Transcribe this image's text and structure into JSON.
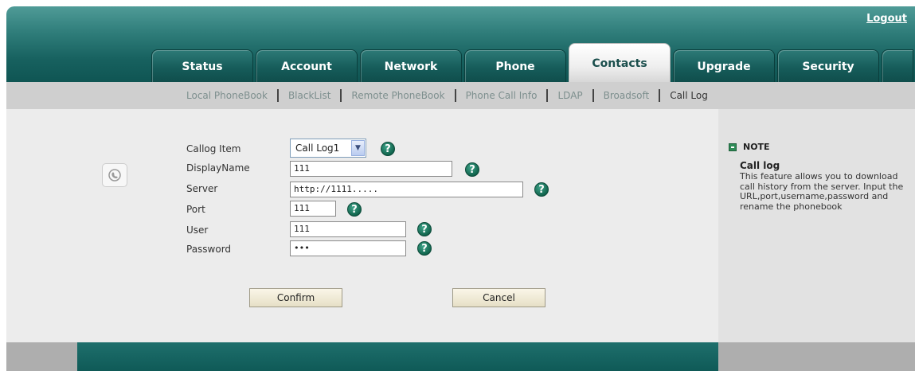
{
  "header": {
    "logout_label": "Logout"
  },
  "tabs": [
    {
      "label": "Status",
      "active": false
    },
    {
      "label": "Account",
      "active": false
    },
    {
      "label": "Network",
      "active": false
    },
    {
      "label": "Phone",
      "active": false
    },
    {
      "label": "Contacts",
      "active": true
    },
    {
      "label": "Upgrade",
      "active": false
    },
    {
      "label": "Security",
      "active": false
    }
  ],
  "subnav": {
    "items": [
      "Local PhoneBook",
      "BlackList",
      "Remote PhoneBook",
      "Phone Call Info",
      "LDAP",
      "Broadsoft",
      "Call Log"
    ],
    "current": "Call Log"
  },
  "form": {
    "calllog_item": {
      "label": "Callog Item",
      "value": "Call Log1"
    },
    "display_name": {
      "label": "DisplayName",
      "value": "111"
    },
    "server": {
      "label": "Server",
      "value": "http://1111....."
    },
    "port": {
      "label": "Port",
      "value": "111"
    },
    "user": {
      "label": "User",
      "value": "111"
    },
    "password": {
      "label": "Password",
      "value": "•••"
    },
    "help_glyph": "?"
  },
  "buttons": {
    "confirm": "Confirm",
    "cancel": "Cancel"
  },
  "note": {
    "title": "NOTE",
    "subtitle": "Call log",
    "text": "This feature allows you to download call history from the server. Input the URL,port,username,password and rename the phonebook"
  },
  "colors": {
    "header_teal": "#17615f",
    "footer_teal": "#0f5a57",
    "help_green": "#0e6049",
    "panel_gray": "#ececec"
  },
  "icons": {
    "side": "phone-book-icon",
    "help": "help-icon",
    "note": "note-icon",
    "dropdown": "chevron-down-icon"
  }
}
